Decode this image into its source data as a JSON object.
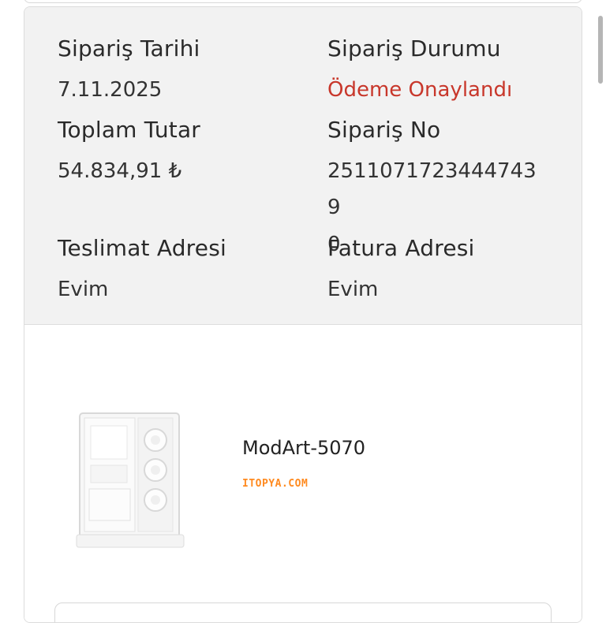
{
  "order": {
    "date_label": "Sipariş Tarihi",
    "date_value": "7.11.2025",
    "status_label": "Sipariş Durumu",
    "status_value": "Ödeme Onaylandı",
    "total_label": "Toplam Tutar",
    "total_value": "54.834,91 ₺",
    "number_label": "Sipariş No",
    "number_value": "25110717234447439\n0",
    "delivery_label": "Teslimat Adresi",
    "delivery_value": "Evim",
    "invoice_label": "Fatura Adresi",
    "invoice_value": "Evim"
  },
  "product": {
    "name": "ModArt-5070",
    "brand": "ITOPYA.COM"
  },
  "colors": {
    "status": "#c8372b",
    "card_background": "#f2f2f2",
    "brand_orange": "#ff8a1f"
  },
  "icons": {
    "product_image": "white-pc-case"
  }
}
